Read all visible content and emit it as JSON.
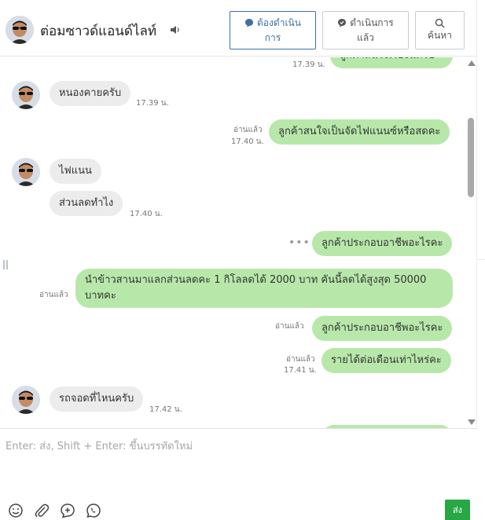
{
  "header": {
    "contact_name": "ต่อมซาวด์แอนด์ไลท์",
    "buttons": {
      "pending_line1": "ต้องดำเนิน",
      "pending_line2": "การ",
      "done_line1": "ดำเนินการ",
      "done_line2": "แล้ว",
      "search": "ค้นหา"
    }
  },
  "messages": {
    "m0": {
      "text": "ลูกค้าสนใจเรื่องนี้ครับ",
      "time": "17.39 น."
    },
    "m1": {
      "text": "หนองคายครับ",
      "time": "17.39 น."
    },
    "m2": {
      "text": "ลูกค้าสนใจเป็นจัดไฟแนนซ์หรือสดคะ",
      "read": "อ่านแล้ว",
      "time": "17.40 น."
    },
    "m3": {
      "text": "ไฟแนน"
    },
    "m4": {
      "text": "ส่วนลดทำไง",
      "time": "17.40 น."
    },
    "m5": {
      "text": "ลูกค้าประกอบอาชีพอะไรคะ",
      "typing": "•••"
    },
    "m6": {
      "text": "นำข้าวสานมาแลกส่วนลดคะ 1 กิโลลดได้ 2000 บาท คันนี้ลดได้สูงสุด 50000 บาทคะ",
      "read": "อ่านแล้ว"
    },
    "m7": {
      "text": "ลูกค้าประกอบอาชีพอะไรคะ",
      "read": "อ่านแล้ว"
    },
    "m8": {
      "text": "รายได้ต่อเดือนเท่าไหร่คะ",
      "read": "อ่านแล้ว",
      "time": "17.41 น."
    },
    "m9": {
      "text": "รถจอดที่ไหนครับ",
      "time": "17.42 น."
    }
  },
  "composer": {
    "placeholder": "Enter: ส่ง, Shift + Enter: ขึ้นบรรทัดใหม่",
    "send_label": "ส่ง"
  },
  "colors": {
    "outgoing_bubble": "#b7e8aa",
    "incoming_bubble": "#ececec",
    "accent": "#3d6fa6",
    "send_button": "#28a745"
  },
  "icons": [
    "speaker-icon",
    "chat-bubble-icon",
    "check-circle-icon",
    "search-icon",
    "emoji-icon",
    "attachment-icon",
    "add-comment-icon",
    "whatsapp-icon"
  ]
}
